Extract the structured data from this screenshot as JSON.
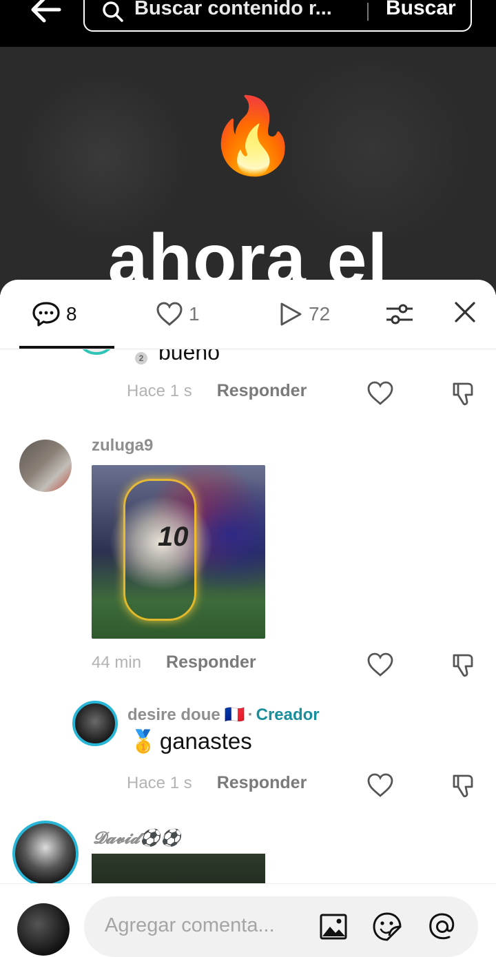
{
  "search": {
    "placeholder": "Buscar contenido r...",
    "button_label": "Buscar"
  },
  "video": {
    "emoji": "🔥",
    "caption": "ahora el"
  },
  "tabs": {
    "comments_count": "8",
    "likes_count": "1",
    "plays_count": "72"
  },
  "comments": [
    {
      "id": "c0",
      "text": "bueno",
      "badge_number": "2",
      "time": "Hace 1 s",
      "reply_label": "Responder"
    },
    {
      "id": "c1",
      "username": "zuluga9",
      "time": "44 min",
      "reply_label": "Responder",
      "image_jersey_number": "10"
    },
    {
      "id": "c2",
      "username": "desire doue",
      "flag": "🇫🇷",
      "separator": "·",
      "creator_label": "Creador",
      "emoji": "🥇",
      "text": "ganastes",
      "time": "Hace 1 s",
      "reply_label": "Responder"
    },
    {
      "id": "c3",
      "username": "𝓓𝓪𝓿𝓲𝓭⚽⚽"
    }
  ],
  "input": {
    "placeholder": "Agregar comenta..."
  },
  "colors": {
    "creator": "#1a8e9a",
    "topbar": "#000000",
    "video_bg": "#2b2b2b"
  }
}
